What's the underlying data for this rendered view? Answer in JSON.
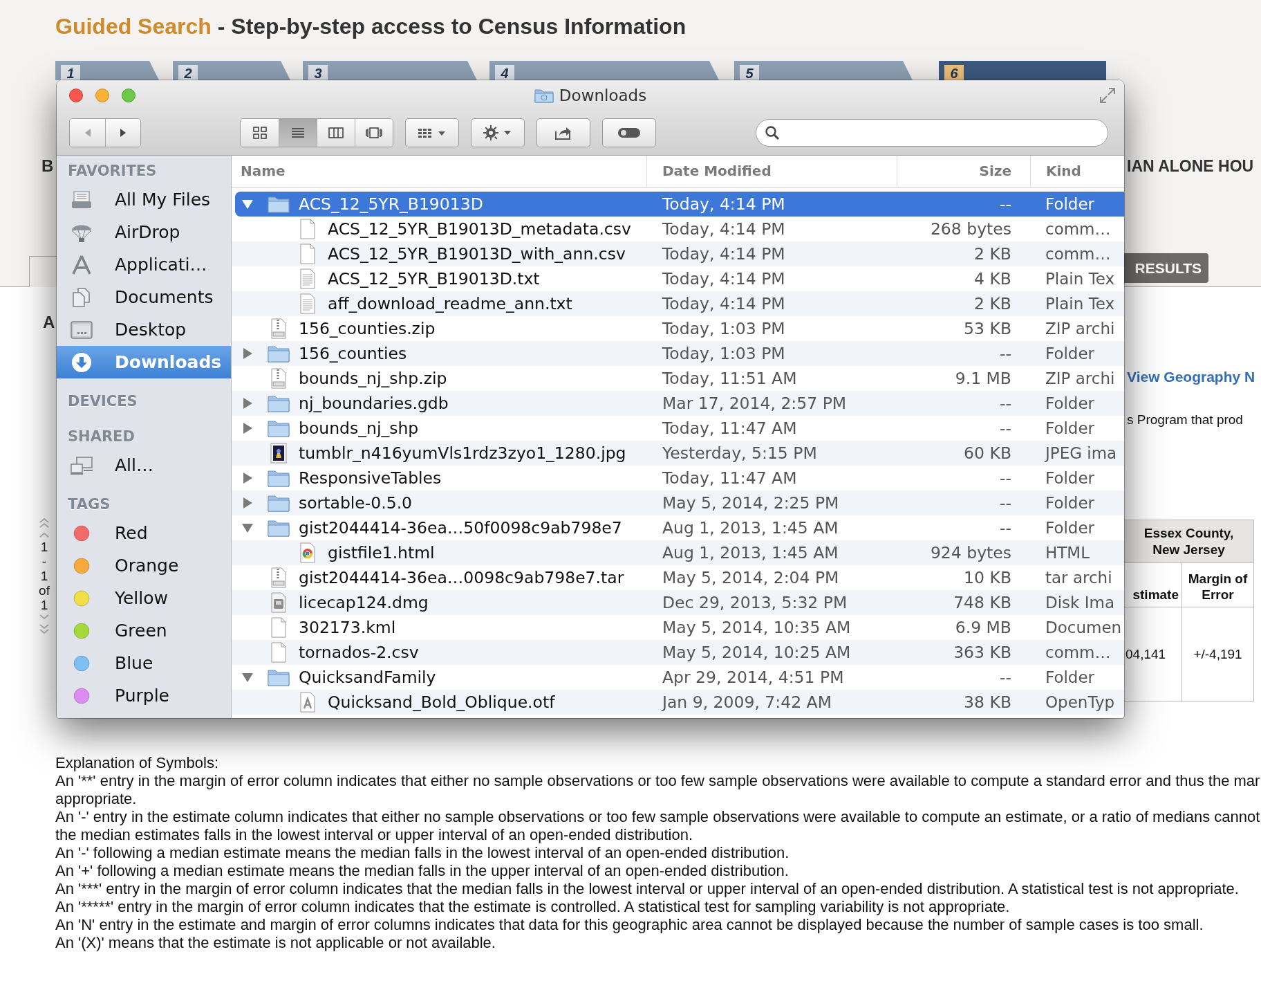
{
  "page": {
    "title_lead": "Guided Search",
    "title_rest": "- Step-by-step access to Census Information",
    "steps": [
      {
        "number": "1",
        "selected": false
      },
      {
        "number": "2",
        "selected": false
      },
      {
        "number": "3",
        "selected": false
      },
      {
        "number": "4",
        "selected": false
      },
      {
        "number": "5",
        "selected": false
      },
      {
        "number": "6",
        "selected": true
      }
    ],
    "left_fragments": {
      "heading": "B",
      "subheading": "A",
      "pager": [
        "1",
        "-",
        "1",
        "of",
        "1"
      ]
    },
    "right_fragments": {
      "heading": "IAN ALONE HOU",
      "results_button": "RESULTS",
      "link": "View Geography N",
      "text": "s Program that prod",
      "table": {
        "header": "Essex County, New Jersey",
        "columns": [
          "stimate",
          "Margin of Error"
        ],
        "cells": [
          "04,141",
          "+/-4,191"
        ]
      }
    },
    "explanation": [
      "Explanation of Symbols:",
      "An '**' entry in the margin of error column indicates that either no sample observations or too few sample observations were available to compute a standard error and thus the mar",
      "appropriate.",
      "An '-' entry in the estimate column indicates that either no sample observations or too few sample observations were available to compute an estimate, or a ratio of medians cannot",
      "the median estimates falls in the lowest interval or upper interval of an open-ended distribution.",
      "An '-' following a median estimate means the median falls in the lowest interval of an open-ended distribution.",
      "An '+' following a median estimate means the median falls in the upper interval of an open-ended distribution.",
      "An '***' entry in the margin of error column indicates that the median falls in the lowest interval or upper interval of an open-ended distribution. A statistical test is not appropriate.",
      "An '*****' entry in the margin of error column indicates that the estimate is controlled. A statistical test for sampling variability is not appropriate.",
      "An 'N' entry in the estimate and margin of error columns indicates that data for this geographic area cannot be displayed because the number of sample cases is too small.",
      "An '(X)' means that the estimate is not applicable or not available."
    ]
  },
  "finder": {
    "title": "Downloads",
    "view_modes": [
      {
        "kind": "icons",
        "selected": false
      },
      {
        "kind": "list",
        "selected": true
      },
      {
        "kind": "columns",
        "selected": false
      },
      {
        "kind": "coverflow",
        "selected": false
      }
    ],
    "sidebar": [
      {
        "title": "FAVORITES",
        "items": [
          {
            "label": "All My Files",
            "kind": "files",
            "selected": false
          },
          {
            "label": "AirDrop",
            "kind": "airdrop",
            "selected": false
          },
          {
            "label": "Applicati…",
            "kind": "applications",
            "selected": false
          },
          {
            "label": "Documents",
            "kind": "documents",
            "selected": false
          },
          {
            "label": "Desktop",
            "kind": "desktop",
            "selected": false
          },
          {
            "label": "Downloads",
            "kind": "downloads",
            "selected": true
          }
        ]
      },
      {
        "title": "DEVICES"
      },
      {
        "title": "SHARED",
        "items": [
          {
            "label": "All…",
            "kind": "network",
            "selected": false
          }
        ]
      },
      {
        "title": "TAGS",
        "items": [
          {
            "label": "Red",
            "kind": "tag",
            "color": "#f26b6b",
            "selected": false
          },
          {
            "label": "Orange",
            "kind": "tag",
            "color": "#f7a93c",
            "selected": false
          },
          {
            "label": "Yellow",
            "kind": "tag",
            "color": "#f0df44",
            "selected": false
          },
          {
            "label": "Green",
            "kind": "tag",
            "color": "#a7d83c",
            "selected": false
          },
          {
            "label": "Blue",
            "kind": "tag",
            "color": "#7cc0f4",
            "selected": false
          },
          {
            "label": "Purple",
            "kind": "tag",
            "color": "#de8cf2",
            "selected": false
          }
        ]
      }
    ],
    "columns": [
      "Name",
      "Date Modified",
      "Size",
      "Kind"
    ],
    "rows": [
      {
        "name": "ACS_12_5YR_B19013D",
        "kind": "folder",
        "expanded": true,
        "selected": true,
        "date_modified": "Today, 4:14 PM",
        "size": "--",
        "kind_label": "Folder",
        "children": [
          {
            "name": "ACS_12_5YR_B19013D_metadata.csv",
            "kind": "document",
            "selected": false,
            "date_modified": "Today, 4:14 PM",
            "size": "268 bytes",
            "kind_label": "comm…"
          },
          {
            "name": "ACS_12_5YR_B19013D_with_ann.csv",
            "kind": "document",
            "selected": false,
            "date_modified": "Today, 4:14 PM",
            "size": "2 KB",
            "kind_label": "comm…"
          },
          {
            "name": "ACS_12_5YR_B19013D.txt",
            "kind": "text",
            "selected": false,
            "date_modified": "Today, 4:14 PM",
            "size": "4 KB",
            "kind_label": "Plain Tex"
          },
          {
            "name": "aff_download_readme_ann.txt",
            "kind": "text",
            "selected": false,
            "date_modified": "Today, 4:14 PM",
            "size": "2 KB",
            "kind_label": "Plain Tex"
          }
        ]
      },
      {
        "name": "156_counties.zip",
        "kind": "zip",
        "selected": false,
        "date_modified": "Today, 1:03 PM",
        "size": "53 KB",
        "kind_label": "ZIP archi"
      },
      {
        "name": "156_counties",
        "kind": "folder",
        "expanded": false,
        "selected": false,
        "date_modified": "Today, 1:03 PM",
        "size": "--",
        "kind_label": "Folder"
      },
      {
        "name": "bounds_nj_shp.zip",
        "kind": "zip",
        "selected": false,
        "date_modified": "Today, 11:51 AM",
        "size": "9.1 MB",
        "kind_label": "ZIP archi"
      },
      {
        "name": "nj_boundaries.gdb",
        "kind": "folder",
        "expanded": false,
        "selected": false,
        "date_modified": "Mar 17, 2014, 2:57 PM",
        "size": "--",
        "kind_label": "Folder"
      },
      {
        "name": "bounds_nj_shp",
        "kind": "folder",
        "expanded": false,
        "selected": false,
        "date_modified": "Today, 11:47 AM",
        "size": "--",
        "kind_label": "Folder"
      },
      {
        "name": "tumblr_n416yumVls1rdz3zyo1_1280.jpg",
        "kind": "image",
        "selected": false,
        "date_modified": "Yesterday, 5:15 PM",
        "size": "60 KB",
        "kind_label": "JPEG ima"
      },
      {
        "name": "ResponsiveTables",
        "kind": "folder",
        "expanded": false,
        "selected": false,
        "date_modified": "Today, 11:47 AM",
        "size": "--",
        "kind_label": "Folder"
      },
      {
        "name": "sortable-0.5.0",
        "kind": "folder",
        "expanded": false,
        "selected": false,
        "date_modified": "May 5, 2014, 2:25 PM",
        "size": "--",
        "kind_label": "Folder"
      },
      {
        "name": "gist2044414-36ea…50f0098c9ab798e7",
        "kind": "folder",
        "expanded": true,
        "selected": false,
        "date_modified": "Aug 1, 2013, 1:45 AM",
        "size": "--",
        "kind_label": "Folder",
        "children": [
          {
            "name": "gistfile1.html",
            "kind": "html",
            "selected": false,
            "date_modified": "Aug 1, 2013, 1:45 AM",
            "size": "924 bytes",
            "kind_label": "HTML"
          }
        ]
      },
      {
        "name": "gist2044414-36ea…0098c9ab798e7.tar",
        "kind": "zip",
        "selected": false,
        "date_modified": "May 5, 2014, 2:04 PM",
        "size": "10 KB",
        "kind_label": "tar archi"
      },
      {
        "name": "licecap124.dmg",
        "kind": "disk",
        "selected": false,
        "date_modified": "Dec 29, 2013, 5:32 PM",
        "size": "748 KB",
        "kind_label": "Disk Ima"
      },
      {
        "name": "302173.kml",
        "kind": "document",
        "selected": false,
        "date_modified": "May 5, 2014, 10:35 AM",
        "size": "6.9 MB",
        "kind_label": "Documen"
      },
      {
        "name": "tornados-2.csv",
        "kind": "document",
        "selected": false,
        "date_modified": "May 5, 2014, 10:25 AM",
        "size": "363 KB",
        "kind_label": "comm…"
      },
      {
        "name": "QuicksandFamily",
        "kind": "folder",
        "expanded": true,
        "selected": false,
        "date_modified": "Apr 29, 2014, 4:51 PM",
        "size": "--",
        "kind_label": "Folder",
        "children": [
          {
            "name": "Quicksand_Bold_Oblique.otf",
            "kind": "font",
            "selected": false,
            "date_modified": "Jan 9, 2009, 7:42 AM",
            "size": "38 KB",
            "kind_label": "OpenTyp"
          }
        ]
      }
    ]
  }
}
